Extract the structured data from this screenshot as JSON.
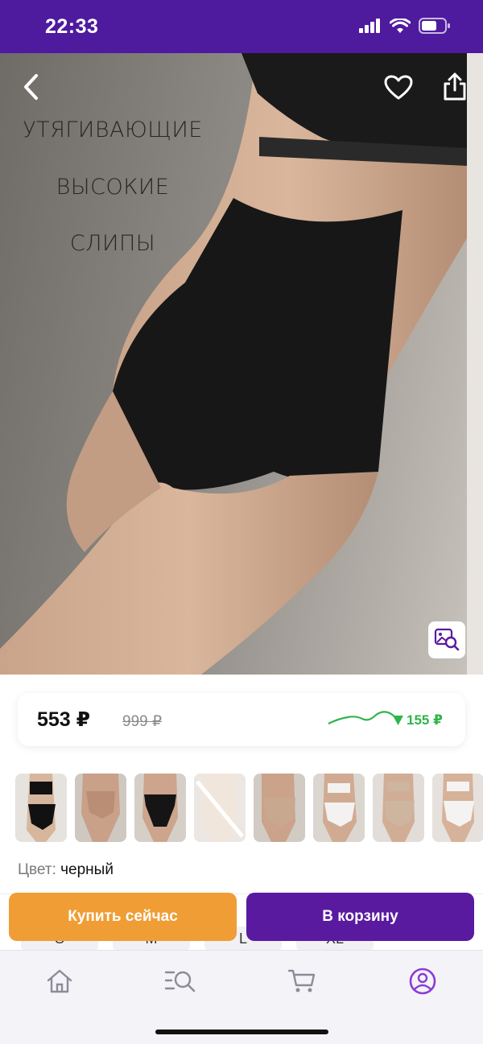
{
  "status_bar": {
    "time": "22:33"
  },
  "hero": {
    "lines": [
      "УТЯГИВАЮЩИЕ",
      "ВЫСОКИЕ",
      "СЛИПЫ"
    ],
    "icons": {
      "back": "chevron-left-icon",
      "favorite": "heart-icon",
      "share": "share-icon",
      "visual_search": "image-search-icon"
    }
  },
  "price": {
    "current": "553 ₽",
    "old": "999 ₽",
    "drop": "155 ₽",
    "drop_color": "#2fb44b"
  },
  "product": {
    "color_label": "Цвет:",
    "color_value": "черный"
  },
  "sizes": [
    "S",
    "M",
    "L",
    "XL"
  ],
  "actions": {
    "buy_now": "Купить сейчас",
    "add_to_cart": "В корзину",
    "buy_now_color": "#f09d35",
    "add_to_cart_color": "#5a1aa0"
  },
  "tab_bar": {
    "items": [
      {
        "name": "home",
        "icon": "home-icon"
      },
      {
        "name": "catalog",
        "icon": "catalog-search-icon"
      },
      {
        "name": "cart",
        "icon": "cart-icon"
      },
      {
        "name": "profile",
        "icon": "profile-icon",
        "active": true
      }
    ],
    "active_color": "#8a3cd6"
  },
  "colors": {
    "brand": "#4e1a9e"
  }
}
